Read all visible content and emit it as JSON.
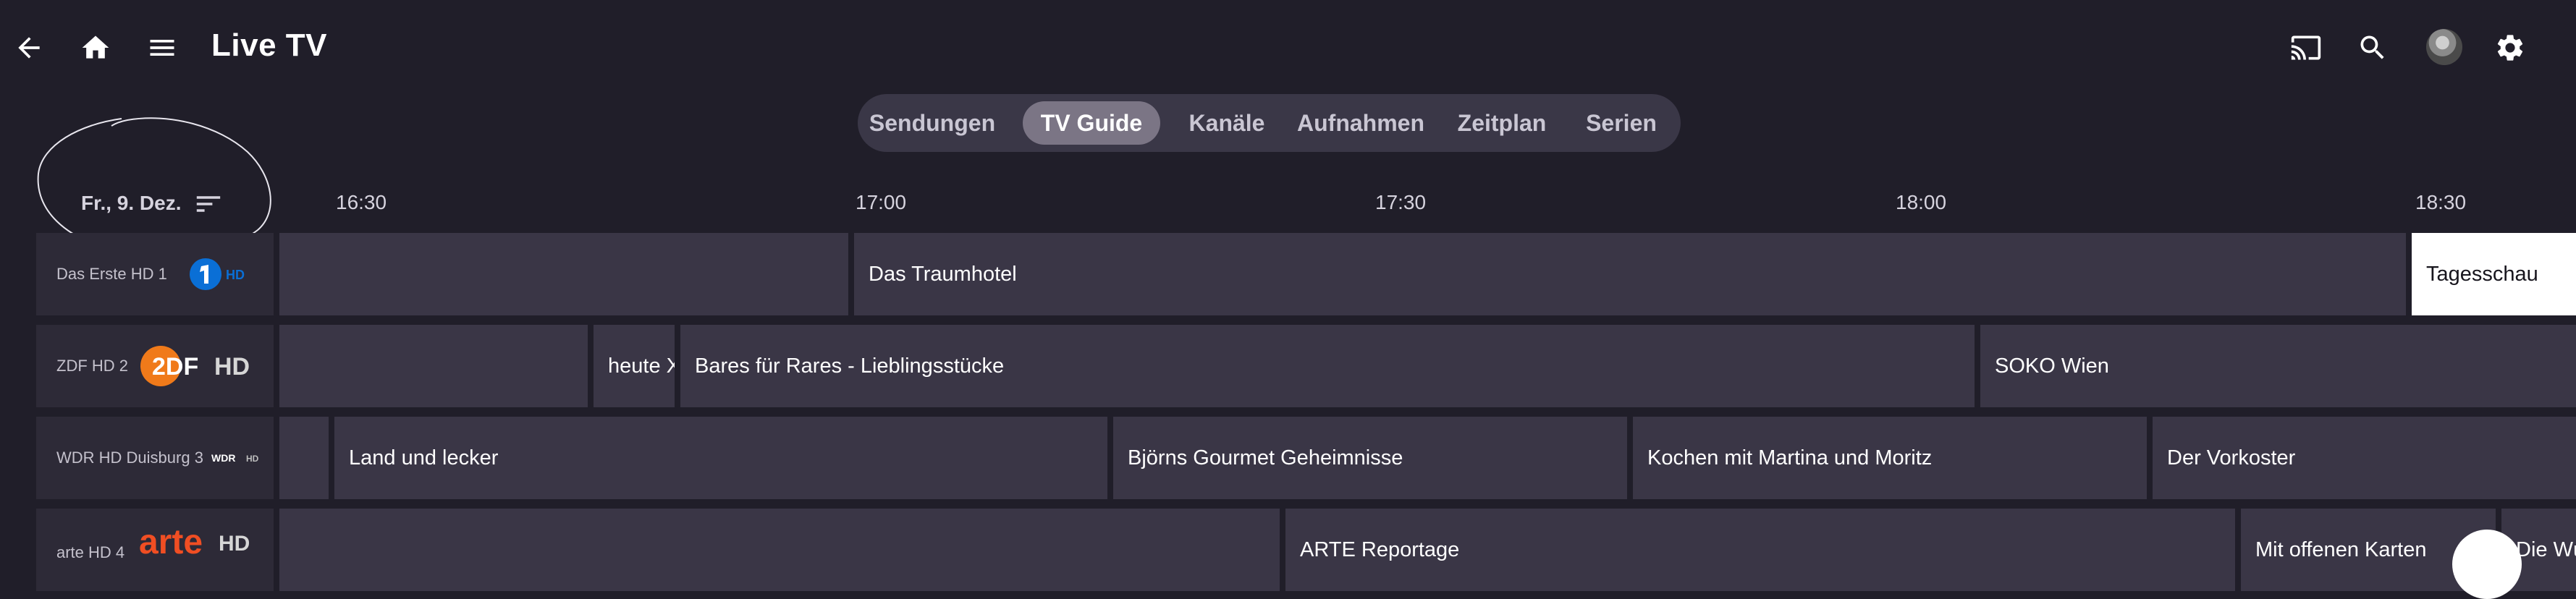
{
  "header": {
    "title": "Live TV",
    "icons": [
      "back-icon",
      "home-icon",
      "menu-icon",
      "cast-icon",
      "search-icon",
      "avatar",
      "settings-icon"
    ]
  },
  "tabs": [
    {
      "label": "Sendungen",
      "active": false
    },
    {
      "label": "TV Guide",
      "active": true
    },
    {
      "label": "Kanäle",
      "active": false
    },
    {
      "label": "Aufnahmen",
      "active": false
    },
    {
      "label": "Zeitplan",
      "active": false
    },
    {
      "label": "Serien",
      "active": false
    }
  ],
  "guide": {
    "date": "Fr., 9. Dez.",
    "times": [
      "16:30",
      "17:00",
      "17:30",
      "18:00",
      "18:30"
    ],
    "channels": [
      {
        "name": "Das Erste HD 1",
        "logo": "das-erste-hd-logo",
        "programs": [
          {
            "title": ""
          },
          {
            "title": "Das Traumhotel"
          },
          {
            "title": "Tagesschau"
          }
        ]
      },
      {
        "name": "ZDF HD 2",
        "logo": "zdf-hd-logo",
        "programs": [
          {
            "title": ""
          },
          {
            "title": "heute Xpress"
          },
          {
            "title": "Bares für Rares - Lieblingsstücke"
          },
          {
            "title": "SOKO Wien"
          }
        ]
      },
      {
        "name": "WDR HD Duisburg 3",
        "logo": "wdr-hd-logo",
        "programs": [
          {
            "title": ""
          },
          {
            "title": "Land und lecker"
          },
          {
            "title": "Björns Gourmet Geheimnisse"
          },
          {
            "title": "Kochen mit Martina und Moritz"
          },
          {
            "title": "Der Vorkoster"
          }
        ]
      },
      {
        "name": "arte HD 4",
        "logo": "arte-hd-logo",
        "programs": [
          {
            "title": ""
          },
          {
            "title": "ARTE Reportage"
          },
          {
            "title": "Mit offenen Karten"
          },
          {
            "title": "Die Wü"
          }
        ]
      }
    ]
  },
  "colors": {
    "background": "#201e29",
    "cell": "#3a3646",
    "channel_cell": "#2d2a37",
    "tab_bar": "#3a3747",
    "tab_active": "#7b7585",
    "now_playing": "#ffffff",
    "zdf_orange": "#f07a1a",
    "das_erste_blue": "#0a6fd6",
    "arte_red": "#f04e23"
  }
}
